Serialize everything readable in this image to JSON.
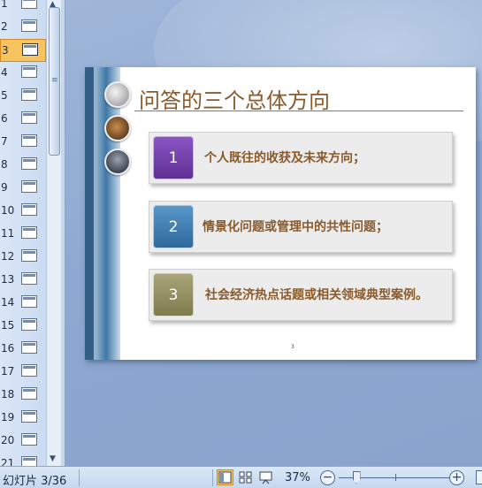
{
  "thumbnails": [
    "1",
    "2",
    "3",
    "4",
    "5",
    "6",
    "7",
    "8",
    "9",
    "10",
    "11",
    "12",
    "13",
    "14",
    "15",
    "16",
    "17",
    "18",
    "19",
    "20",
    "21"
  ],
  "selected_thumbnail": "3",
  "slide": {
    "title": "问答的三个总体方向",
    "items": [
      {
        "number": "1",
        "text": "个人既往的收获及未来方向；",
        "color": "#6f3ea8"
      },
      {
        "number": "2",
        "text": "情景化问题或管理中的共性问题；",
        "color": "#3d76a8"
      },
      {
        "number": "3",
        "text": "社会经济热点话题或相关领域典型案例。",
        "color": "#918d5f"
      }
    ],
    "page_number": "3"
  },
  "statusbar": {
    "slide_counter": "幻灯片 3/36",
    "zoom_level": "37%",
    "zoom_out": "−",
    "zoom_in": "+"
  },
  "zoom_fraction": 0.37,
  "icons": {
    "view_normal": "normal-view-icon",
    "view_sorter": "slide-sorter-icon",
    "view_show": "slide-show-icon",
    "zoom_out": "zoom-out-icon",
    "zoom_in": "zoom-in-icon",
    "fit": "fit-to-window-icon"
  }
}
